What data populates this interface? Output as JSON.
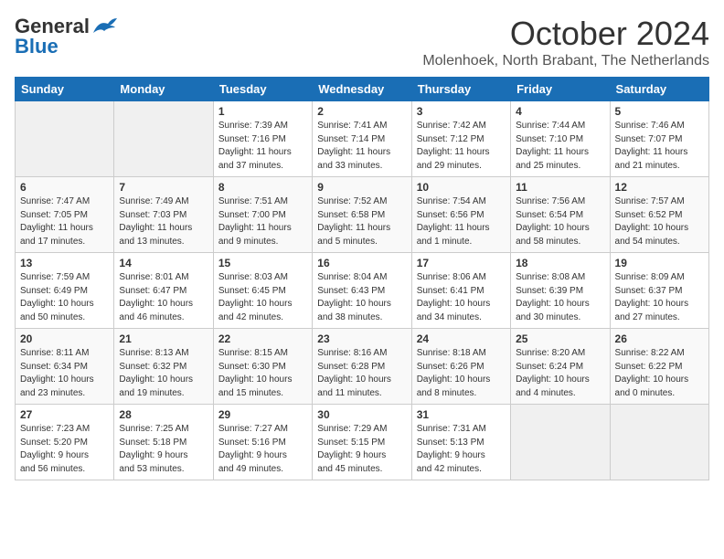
{
  "header": {
    "logo_general": "General",
    "logo_blue": "Blue",
    "month": "October 2024",
    "location": "Molenhoek, North Brabant, The Netherlands"
  },
  "weekdays": [
    "Sunday",
    "Monday",
    "Tuesday",
    "Wednesday",
    "Thursday",
    "Friday",
    "Saturday"
  ],
  "weeks": [
    [
      {
        "day": "",
        "info": ""
      },
      {
        "day": "",
        "info": ""
      },
      {
        "day": "1",
        "info": "Sunrise: 7:39 AM\nSunset: 7:16 PM\nDaylight: 11 hours\nand 37 minutes."
      },
      {
        "day": "2",
        "info": "Sunrise: 7:41 AM\nSunset: 7:14 PM\nDaylight: 11 hours\nand 33 minutes."
      },
      {
        "day": "3",
        "info": "Sunrise: 7:42 AM\nSunset: 7:12 PM\nDaylight: 11 hours\nand 29 minutes."
      },
      {
        "day": "4",
        "info": "Sunrise: 7:44 AM\nSunset: 7:10 PM\nDaylight: 11 hours\nand 25 minutes."
      },
      {
        "day": "5",
        "info": "Sunrise: 7:46 AM\nSunset: 7:07 PM\nDaylight: 11 hours\nand 21 minutes."
      }
    ],
    [
      {
        "day": "6",
        "info": "Sunrise: 7:47 AM\nSunset: 7:05 PM\nDaylight: 11 hours\nand 17 minutes."
      },
      {
        "day": "7",
        "info": "Sunrise: 7:49 AM\nSunset: 7:03 PM\nDaylight: 11 hours\nand 13 minutes."
      },
      {
        "day": "8",
        "info": "Sunrise: 7:51 AM\nSunset: 7:00 PM\nDaylight: 11 hours\nand 9 minutes."
      },
      {
        "day": "9",
        "info": "Sunrise: 7:52 AM\nSunset: 6:58 PM\nDaylight: 11 hours\nand 5 minutes."
      },
      {
        "day": "10",
        "info": "Sunrise: 7:54 AM\nSunset: 6:56 PM\nDaylight: 11 hours\nand 1 minute."
      },
      {
        "day": "11",
        "info": "Sunrise: 7:56 AM\nSunset: 6:54 PM\nDaylight: 10 hours\nand 58 minutes."
      },
      {
        "day": "12",
        "info": "Sunrise: 7:57 AM\nSunset: 6:52 PM\nDaylight: 10 hours\nand 54 minutes."
      }
    ],
    [
      {
        "day": "13",
        "info": "Sunrise: 7:59 AM\nSunset: 6:49 PM\nDaylight: 10 hours\nand 50 minutes."
      },
      {
        "day": "14",
        "info": "Sunrise: 8:01 AM\nSunset: 6:47 PM\nDaylight: 10 hours\nand 46 minutes."
      },
      {
        "day": "15",
        "info": "Sunrise: 8:03 AM\nSunset: 6:45 PM\nDaylight: 10 hours\nand 42 minutes."
      },
      {
        "day": "16",
        "info": "Sunrise: 8:04 AM\nSunset: 6:43 PM\nDaylight: 10 hours\nand 38 minutes."
      },
      {
        "day": "17",
        "info": "Sunrise: 8:06 AM\nSunset: 6:41 PM\nDaylight: 10 hours\nand 34 minutes."
      },
      {
        "day": "18",
        "info": "Sunrise: 8:08 AM\nSunset: 6:39 PM\nDaylight: 10 hours\nand 30 minutes."
      },
      {
        "day": "19",
        "info": "Sunrise: 8:09 AM\nSunset: 6:37 PM\nDaylight: 10 hours\nand 27 minutes."
      }
    ],
    [
      {
        "day": "20",
        "info": "Sunrise: 8:11 AM\nSunset: 6:34 PM\nDaylight: 10 hours\nand 23 minutes."
      },
      {
        "day": "21",
        "info": "Sunrise: 8:13 AM\nSunset: 6:32 PM\nDaylight: 10 hours\nand 19 minutes."
      },
      {
        "day": "22",
        "info": "Sunrise: 8:15 AM\nSunset: 6:30 PM\nDaylight: 10 hours\nand 15 minutes."
      },
      {
        "day": "23",
        "info": "Sunrise: 8:16 AM\nSunset: 6:28 PM\nDaylight: 10 hours\nand 11 minutes."
      },
      {
        "day": "24",
        "info": "Sunrise: 8:18 AM\nSunset: 6:26 PM\nDaylight: 10 hours\nand 8 minutes."
      },
      {
        "day": "25",
        "info": "Sunrise: 8:20 AM\nSunset: 6:24 PM\nDaylight: 10 hours\nand 4 minutes."
      },
      {
        "day": "26",
        "info": "Sunrise: 8:22 AM\nSunset: 6:22 PM\nDaylight: 10 hours\nand 0 minutes."
      }
    ],
    [
      {
        "day": "27",
        "info": "Sunrise: 7:23 AM\nSunset: 5:20 PM\nDaylight: 9 hours\nand 56 minutes."
      },
      {
        "day": "28",
        "info": "Sunrise: 7:25 AM\nSunset: 5:18 PM\nDaylight: 9 hours\nand 53 minutes."
      },
      {
        "day": "29",
        "info": "Sunrise: 7:27 AM\nSunset: 5:16 PM\nDaylight: 9 hours\nand 49 minutes."
      },
      {
        "day": "30",
        "info": "Sunrise: 7:29 AM\nSunset: 5:15 PM\nDaylight: 9 hours\nand 45 minutes."
      },
      {
        "day": "31",
        "info": "Sunrise: 7:31 AM\nSunset: 5:13 PM\nDaylight: 9 hours\nand 42 minutes."
      },
      {
        "day": "",
        "info": ""
      },
      {
        "day": "",
        "info": ""
      }
    ]
  ]
}
